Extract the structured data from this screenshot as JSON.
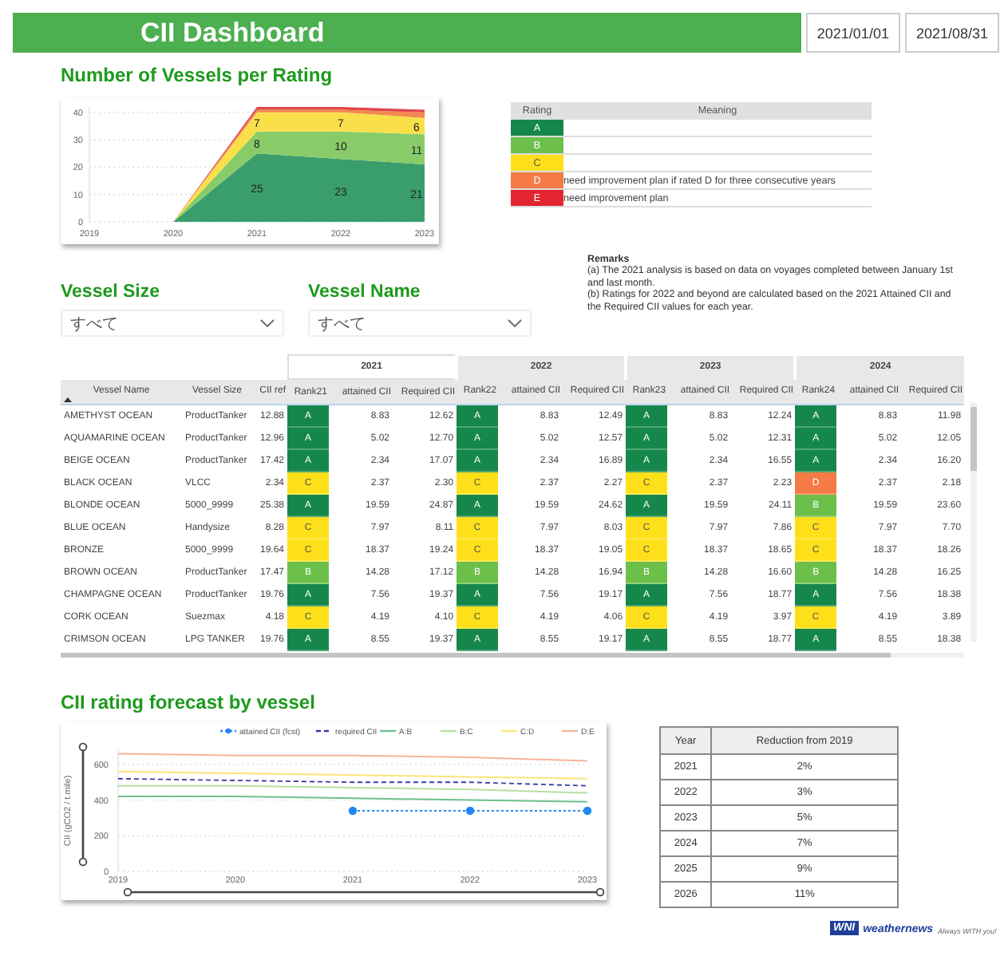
{
  "header": {
    "title": "CII Dashboard",
    "dates": [
      "2021/01/01",
      "2021/08/31"
    ]
  },
  "rating_chart": {
    "title": "Number of Vessels per Rating",
    "chart_data": {
      "type": "area",
      "stacked": true,
      "grid": true,
      "categories": [
        "2019",
        "2020",
        "2021",
        "2022",
        "2023"
      ],
      "ylim": [
        0,
        42
      ],
      "yticks": [
        0,
        10,
        20,
        30,
        40
      ],
      "series": [
        {
          "color": "#3a9e6c",
          "values": [
            null,
            0,
            25,
            23,
            21
          ],
          "value_labels": [
            null,
            null,
            "25",
            "23",
            "21"
          ]
        },
        {
          "color": "#88cc6a",
          "values": [
            null,
            0,
            8,
            10,
            11
          ],
          "value_labels": [
            null,
            null,
            "8",
            "10",
            "11"
          ]
        },
        {
          "color": "#f9e04b",
          "values": [
            null,
            0,
            7,
            7,
            6
          ],
          "value_labels": [
            null,
            null,
            "7",
            "7",
            "6"
          ]
        },
        {
          "color": "#f2894e",
          "values": [
            null,
            0,
            1,
            1,
            2
          ]
        },
        {
          "color": "#e0474c",
          "values": [
            null,
            0,
            1,
            1,
            1
          ]
        }
      ]
    }
  },
  "rating_legend": {
    "columns": [
      "Rating",
      "Meaning"
    ],
    "rows": [
      {
        "rating": "A",
        "color": "#16874a"
      },
      {
        "rating": "B",
        "color": "#6cc04a"
      },
      {
        "rating": "C",
        "color": "#fde01a"
      },
      {
        "rating": "D",
        "color": "#f47b45",
        "meaning": "need improvement plan if rated D for three consecutive years"
      },
      {
        "rating": "E",
        "color": "#e32532",
        "meaning": "need improvement plan"
      }
    ]
  },
  "remarks": {
    "title": "Remarks",
    "lines": [
      "(a) The 2021 analysis is based on data on voyages completed between January 1st and last month.",
      "(b) Ratings for 2022 and beyond are calculated based on the 2021 Attained CII and the Required CII values for each year."
    ]
  },
  "filters": [
    {
      "label": "Vessel Size",
      "value": "すべて"
    },
    {
      "label": "Vessel Name",
      "value": "すべて"
    }
  ],
  "vessel_table": {
    "years": [
      {
        "label": "2021",
        "selected": true
      },
      {
        "label": "2022",
        "selected": false
      },
      {
        "label": "2023",
        "selected": false
      },
      {
        "label": "2024",
        "selected": false
      }
    ],
    "columns": [
      {
        "label": "Vessel Name",
        "sorted": true
      },
      {
        "label": "Vessel Size",
        "sorted": false
      },
      {
        "label": "CII ref",
        "sorted": false
      },
      {
        "label": "Rank21",
        "sorted": false
      },
      {
        "label": "attained CII",
        "sorted": false
      },
      {
        "label": "Required CII",
        "sorted": false
      },
      {
        "label": "Rank22",
        "sorted": false
      },
      {
        "label": "attained CII",
        "sorted": false
      },
      {
        "label": "Required CII",
        "sorted": false
      },
      {
        "label": "Rank23",
        "sorted": false
      },
      {
        "label": "attained CII",
        "sorted": false
      },
      {
        "label": "Required CII",
        "sorted": false
      },
      {
        "label": "Rank24",
        "sorted": false
      },
      {
        "label": "attained CII",
        "sorted": false
      },
      {
        "label": "Required CII",
        "sorted": false
      }
    ],
    "rows": [
      {
        "name": "AMETHYST OCEAN",
        "size": "ProductTanker",
        "cii_ref": "12.88",
        "years": [
          {
            "rank": "A",
            "color": "#16874a",
            "attained": "8.83",
            "required": "12.62"
          },
          {
            "rank": "A",
            "color": "#16874a",
            "attained": "8.83",
            "required": "12.49"
          },
          {
            "rank": "A",
            "color": "#16874a",
            "attained": "8.83",
            "required": "12.24"
          },
          {
            "rank": "A",
            "color": "#16874a",
            "attained": "8.83",
            "required": "11.98"
          }
        ]
      },
      {
        "name": "AQUAMARINE OCEAN",
        "size": "ProductTanker",
        "cii_ref": "12.96",
        "years": [
          {
            "rank": "A",
            "color": "#16874a",
            "attained": "5.02",
            "required": "12.70"
          },
          {
            "rank": "A",
            "color": "#16874a",
            "attained": "5.02",
            "required": "12.57"
          },
          {
            "rank": "A",
            "color": "#16874a",
            "attained": "5.02",
            "required": "12.31"
          },
          {
            "rank": "A",
            "color": "#16874a",
            "attained": "5.02",
            "required": "12.05"
          }
        ]
      },
      {
        "name": "BEIGE OCEAN",
        "size": "ProductTanker",
        "cii_ref": "17.42",
        "years": [
          {
            "rank": "A",
            "color": "#16874a",
            "attained": "2.34",
            "required": "17.07"
          },
          {
            "rank": "A",
            "color": "#16874a",
            "attained": "2.34",
            "required": "16.89"
          },
          {
            "rank": "A",
            "color": "#16874a",
            "attained": "2.34",
            "required": "16.55"
          },
          {
            "rank": "A",
            "color": "#16874a",
            "attained": "2.34",
            "required": "16.20"
          }
        ]
      },
      {
        "name": "BLACK OCEAN",
        "size": "VLCC",
        "cii_ref": "2.34",
        "years": [
          {
            "rank": "C",
            "color": "#fde01a",
            "attained": "2.37",
            "required": "2.30"
          },
          {
            "rank": "C",
            "color": "#fde01a",
            "attained": "2.37",
            "required": "2.27"
          },
          {
            "rank": "C",
            "color": "#fde01a",
            "attained": "2.37",
            "required": "2.23"
          },
          {
            "rank": "D",
            "color": "#f47b45",
            "attained": "2.37",
            "required": "2.18"
          }
        ]
      },
      {
        "name": "BLONDE OCEAN",
        "size": "5000_9999",
        "cii_ref": "25.38",
        "years": [
          {
            "rank": "A",
            "color": "#16874a",
            "attained": "19.59",
            "required": "24.87"
          },
          {
            "rank": "A",
            "color": "#16874a",
            "attained": "19.59",
            "required": "24.62"
          },
          {
            "rank": "A",
            "color": "#16874a",
            "attained": "19.59",
            "required": "24.11"
          },
          {
            "rank": "B",
            "color": "#6cc04a",
            "attained": "19.59",
            "required": "23.60"
          }
        ]
      },
      {
        "name": "BLUE OCEAN",
        "size": "Handysize",
        "cii_ref": "8.28",
        "years": [
          {
            "rank": "C",
            "color": "#fde01a",
            "attained": "7.97",
            "required": "8.11"
          },
          {
            "rank": "C",
            "color": "#fde01a",
            "attained": "7.97",
            "required": "8.03"
          },
          {
            "rank": "C",
            "color": "#fde01a",
            "attained": "7.97",
            "required": "7.86"
          },
          {
            "rank": "C",
            "color": "#fde01a",
            "attained": "7.97",
            "required": "7.70"
          }
        ]
      },
      {
        "name": "BRONZE",
        "size": "5000_9999",
        "cii_ref": "19.64",
        "years": [
          {
            "rank": "C",
            "color": "#fde01a",
            "attained": "18.37",
            "required": "19.24"
          },
          {
            "rank": "C",
            "color": "#fde01a",
            "attained": "18.37",
            "required": "19.05"
          },
          {
            "rank": "C",
            "color": "#fde01a",
            "attained": "18.37",
            "required": "18.65"
          },
          {
            "rank": "C",
            "color": "#fde01a",
            "attained": "18.37",
            "required": "18.26"
          }
        ]
      },
      {
        "name": "BROWN OCEAN",
        "size": "ProductTanker",
        "cii_ref": "17.47",
        "years": [
          {
            "rank": "B",
            "color": "#6cc04a",
            "attained": "14.28",
            "required": "17.12"
          },
          {
            "rank": "B",
            "color": "#6cc04a",
            "attained": "14.28",
            "required": "16.94"
          },
          {
            "rank": "B",
            "color": "#6cc04a",
            "attained": "14.28",
            "required": "16.60"
          },
          {
            "rank": "B",
            "color": "#6cc04a",
            "attained": "14.28",
            "required": "16.25"
          }
        ]
      },
      {
        "name": "CHAMPAGNE OCEAN",
        "size": "ProductTanker",
        "cii_ref": "19.76",
        "years": [
          {
            "rank": "A",
            "color": "#16874a",
            "attained": "7.56",
            "required": "19.37"
          },
          {
            "rank": "A",
            "color": "#16874a",
            "attained": "7.56",
            "required": "19.17"
          },
          {
            "rank": "A",
            "color": "#16874a",
            "attained": "7.56",
            "required": "18.77"
          },
          {
            "rank": "A",
            "color": "#16874a",
            "attained": "7.56",
            "required": "18.38"
          }
        ]
      },
      {
        "name": "CORK OCEAN",
        "size": "Suezmax",
        "cii_ref": "4.18",
        "years": [
          {
            "rank": "C",
            "color": "#fde01a",
            "attained": "4.19",
            "required": "4.10"
          },
          {
            "rank": "C",
            "color": "#fde01a",
            "attained": "4.19",
            "required": "4.06"
          },
          {
            "rank": "C",
            "color": "#fde01a",
            "attained": "4.19",
            "required": "3.97"
          },
          {
            "rank": "C",
            "color": "#fde01a",
            "attained": "4.19",
            "required": "3.89"
          }
        ]
      },
      {
        "name": "CRIMSON OCEAN",
        "size": "LPG TANKER",
        "cii_ref": "19.76",
        "years": [
          {
            "rank": "A",
            "color": "#16874a",
            "attained": "8.55",
            "required": "19.37"
          },
          {
            "rank": "A",
            "color": "#16874a",
            "attained": "8.55",
            "required": "19.17"
          },
          {
            "rank": "A",
            "color": "#16874a",
            "attained": "8.55",
            "required": "18.77"
          },
          {
            "rank": "A",
            "color": "#16874a",
            "attained": "8.55",
            "required": "18.38"
          }
        ]
      }
    ]
  },
  "forecast": {
    "title": "CII rating forecast by vessel",
    "chart_data": {
      "type": "line",
      "ylabel": "CII (gCO2 / t.mile)",
      "x": [
        "2019",
        "2020",
        "2021",
        "2022",
        "2023"
      ],
      "ylim": [
        0,
        680
      ],
      "yticks": [
        0,
        200,
        400,
        600
      ],
      "grid": true,
      "legend": "top",
      "series": [
        {
          "name": "attained CII (fcst)",
          "color": "#1e88f0",
          "line_style": "dotted",
          "marker": "circle",
          "values": [
            null,
            null,
            340,
            340,
            340
          ]
        },
        {
          "name": "required CII",
          "color": "#3a3aa8",
          "line_style": "dashed",
          "values": [
            520,
            510,
            500,
            500,
            480
          ]
        },
        {
          "name": "A:B",
          "color": "#6fbf8e",
          "line_style": "solid",
          "values": [
            420,
            420,
            410,
            400,
            390
          ]
        },
        {
          "name": "B:C",
          "color": "#b4e0a0",
          "line_style": "solid",
          "values": [
            480,
            480,
            470,
            460,
            440
          ]
        },
        {
          "name": "C:D",
          "color": "#fbe57a",
          "line_style": "solid",
          "values": [
            560,
            550,
            540,
            530,
            520
          ]
        },
        {
          "name": "D:E",
          "color": "#f7b49a",
          "line_style": "solid",
          "values": [
            660,
            650,
            650,
            640,
            620
          ]
        }
      ]
    }
  },
  "reduction_table": {
    "columns": [
      "Year",
      "Reduction from 2019"
    ],
    "rows": [
      [
        "2021",
        "2%"
      ],
      [
        "2022",
        "3%"
      ],
      [
        "2023",
        "5%"
      ],
      [
        "2024",
        "7%"
      ],
      [
        "2025",
        "9%"
      ],
      [
        "2026",
        "11%"
      ]
    ]
  },
  "logo": {
    "mark": "WNI",
    "name": "weathernews",
    "tagline": "Always WITH you!"
  }
}
